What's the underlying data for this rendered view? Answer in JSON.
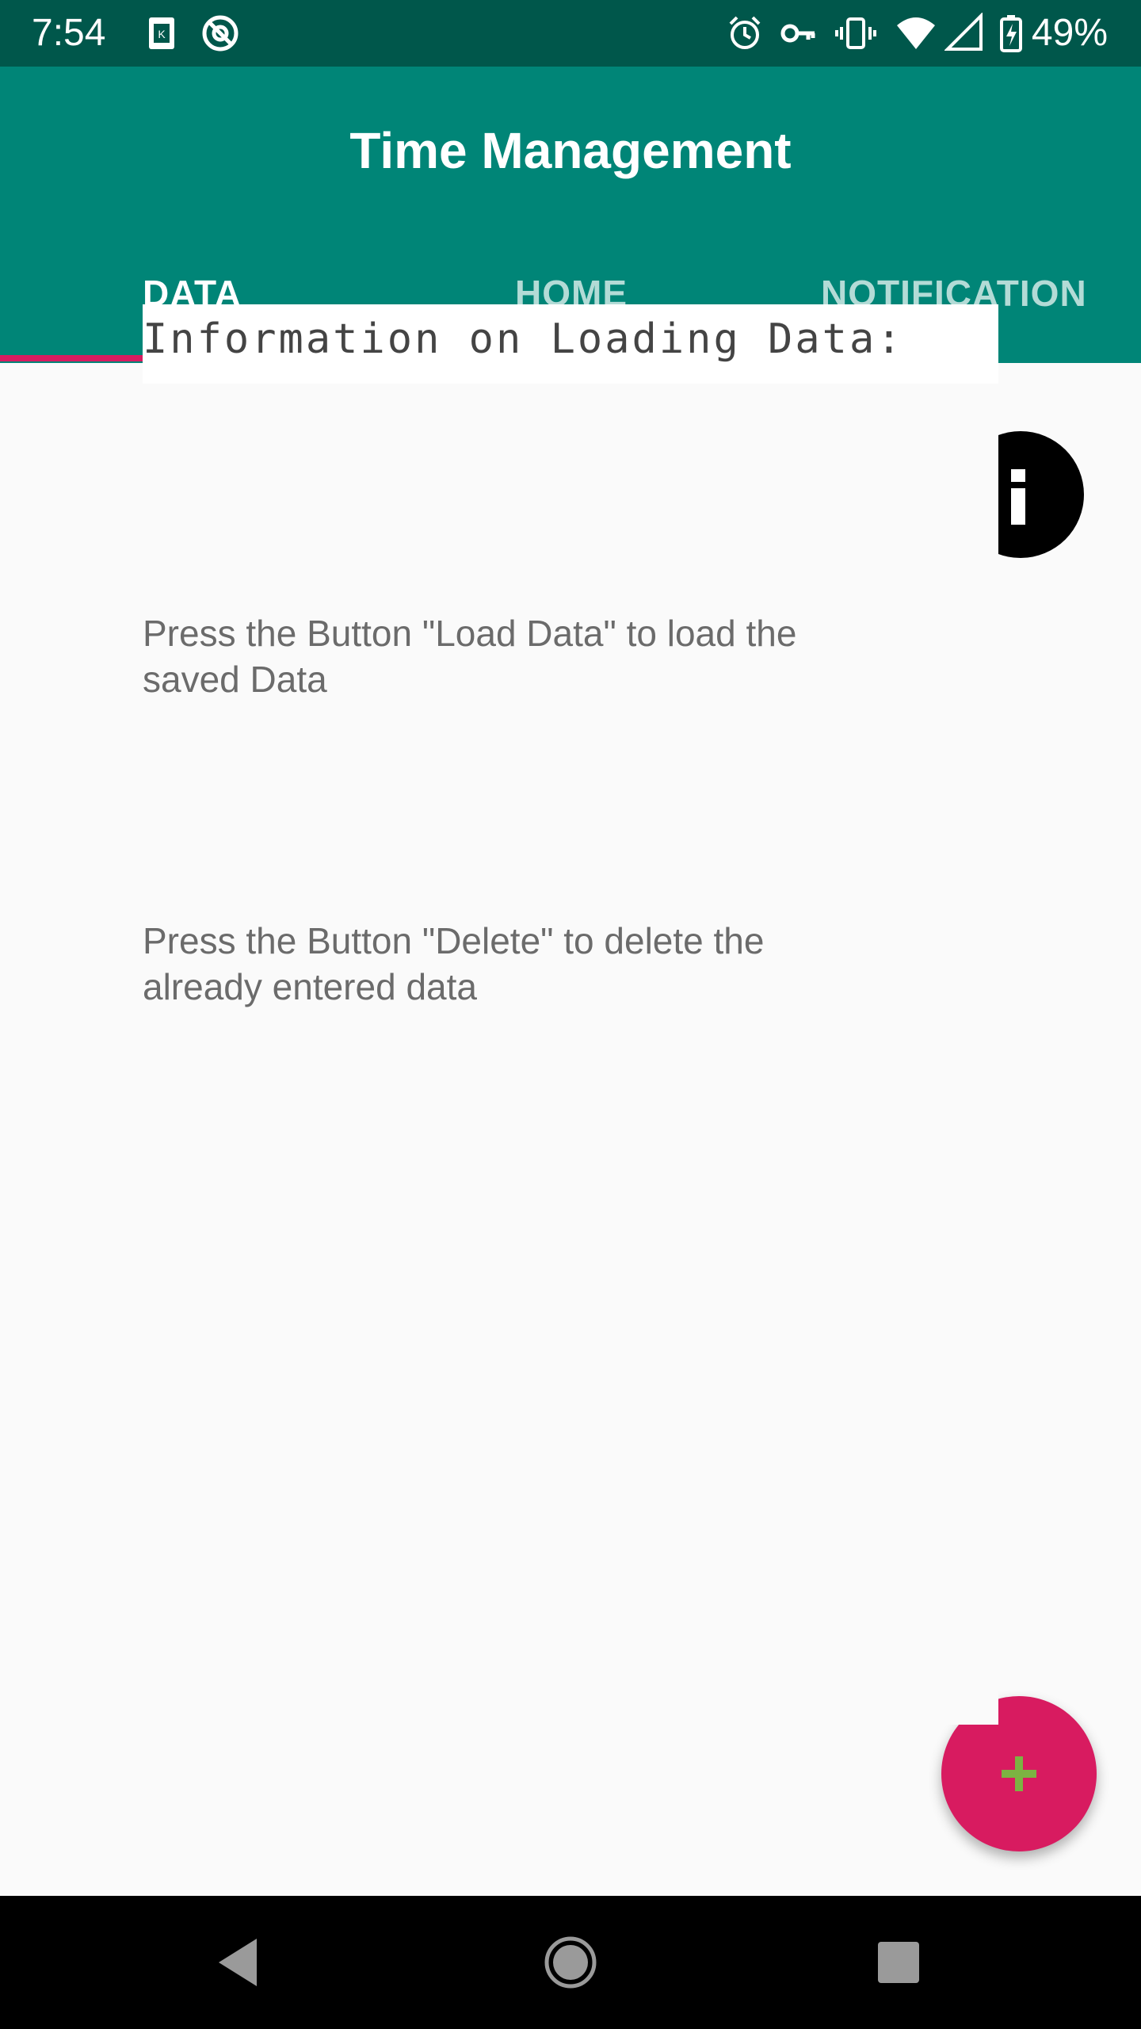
{
  "status_bar": {
    "time": "7:54",
    "battery_percent": "49%",
    "icons": [
      "sim-card-icon",
      "no-disturb-icon",
      "alarm-icon",
      "vpn-key-icon",
      "vibrate-icon",
      "wifi-icon",
      "signal-icon",
      "battery-charging-icon"
    ]
  },
  "app_bar": {
    "title": "Time Management",
    "background": "#008577",
    "tabs": [
      {
        "label": "DATA",
        "active": true
      },
      {
        "label": "HOME",
        "active": false
      },
      {
        "label": "NOTIFICATION",
        "active": false
      }
    ],
    "indicator_color": "#D81B60"
  },
  "content": {
    "info_header": "Information on Loading Data:",
    "info_icon": "info-icon",
    "paragraph_load": "Press the Button \"Load Data\" to load the saved Data",
    "paragraph_delete": "Press the Button \"Delete\" to delete the already entered data"
  },
  "fab": {
    "icon": "plus-icon",
    "color": "#D81B60",
    "icon_color": "#7CB342"
  },
  "nav_bar": {
    "icons": [
      "back-icon",
      "home-icon",
      "recents-icon"
    ]
  }
}
